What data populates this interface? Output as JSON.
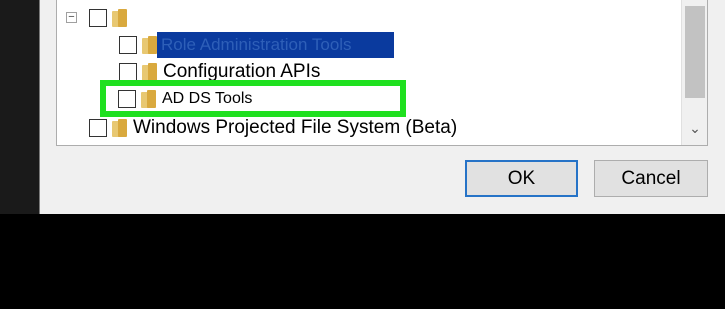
{
  "tree": {
    "items": [
      {
        "label": "",
        "checked": false,
        "expander": "−"
      },
      {
        "label": "Role Administration Tools",
        "checked": false,
        "selected": true
      },
      {
        "label": "Configuration APIs",
        "checked": false
      },
      {
        "label": "AD DS Tools",
        "checked": false,
        "highlighted": true
      },
      {
        "label": "Windows Projected File System (Beta)",
        "checked": false
      },
      {
        "label": "",
        "checked": false
      }
    ]
  },
  "scrollbar": {
    "down_arrow": "⌄"
  },
  "buttons": {
    "ok": "OK",
    "cancel": "Cancel"
  },
  "colors": {
    "highlight": "#1fe01f",
    "selection": "#0a3a9e",
    "ok_border": "#2673c7"
  }
}
